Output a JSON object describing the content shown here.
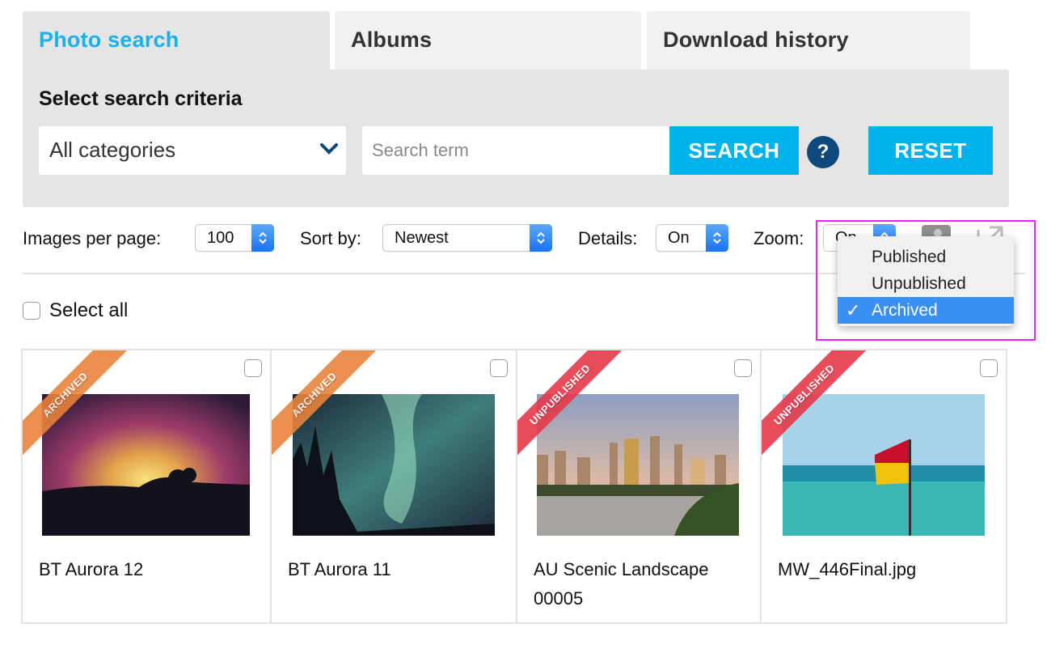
{
  "tabs": [
    {
      "label": "Photo search",
      "active": true
    },
    {
      "label": "Albums",
      "active": false
    },
    {
      "label": "Download history",
      "active": false
    }
  ],
  "criteria": {
    "title": "Select search criteria",
    "category_value": "All categories",
    "search_placeholder": "Search term",
    "search_value": "",
    "search_button": "SEARCH",
    "help_glyph": "?",
    "reset_button": "RESET"
  },
  "toolbar": {
    "images_per_page_label": "Images per page:",
    "images_per_page_value": "100",
    "sort_label": "Sort by:",
    "sort_value": "Newest",
    "details_label": "Details:",
    "details_value": "On",
    "zoom_label": "Zoom:",
    "zoom_value": "On",
    "icons": [
      "user-icon",
      "external-link-icon"
    ]
  },
  "status_dropdown": {
    "options": [
      {
        "label": "Published",
        "selected": false
      },
      {
        "label": "Unpublished",
        "selected": false
      },
      {
        "label": "Archived",
        "selected": true
      }
    ],
    "check_glyph": "✓"
  },
  "select_all_label": "Select all",
  "colors": {
    "accent": "#1ab0ea",
    "button_blue": "#00b2ec",
    "help_navy": "#0d4a7b",
    "archived_ribbon": "#e8833a",
    "unpublished_ribbon": "#e6394a",
    "dropdown_selected": "#3a8ff5",
    "highlight": "#ee22ee"
  },
  "photos": [
    {
      "title": "BT Aurora 12",
      "status": "ARCHIVED",
      "checked": false
    },
    {
      "title": "BT Aurora 11",
      "status": "ARCHIVED",
      "checked": false
    },
    {
      "title": "AU Scenic Landscape 00005",
      "status": "UNPUBLISHED",
      "checked": false
    },
    {
      "title": "MW_446Final.jpg",
      "status": "UNPUBLISHED",
      "checked": false
    }
  ]
}
